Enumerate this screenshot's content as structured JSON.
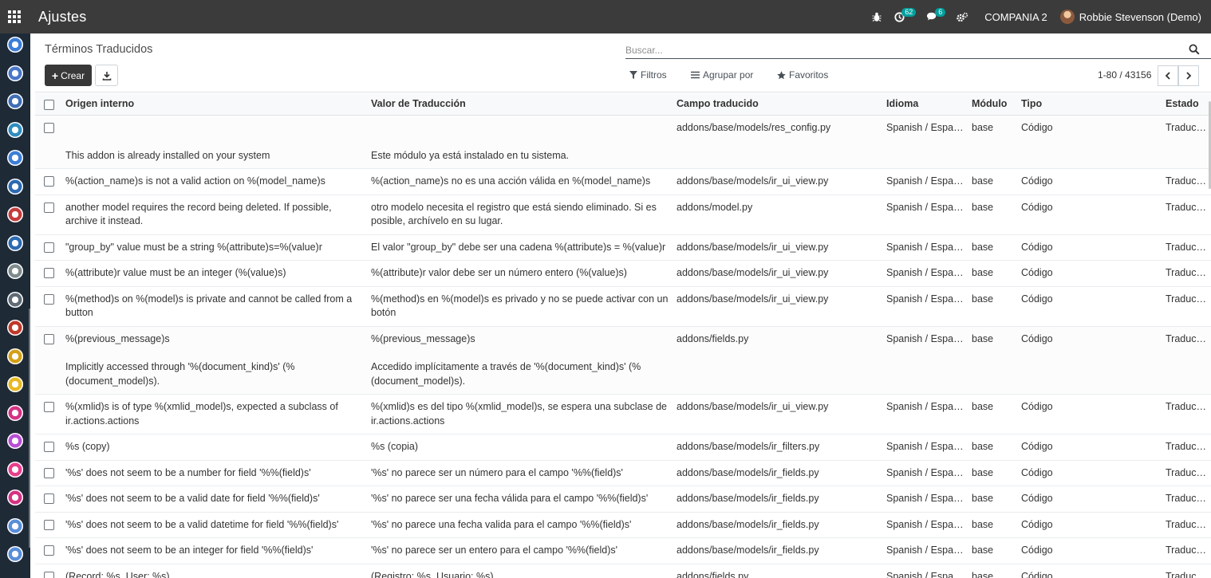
{
  "navbar": {
    "app_title": "Ajustes",
    "activity_count": "62",
    "messages_count": "6",
    "company": "COMPANIA 2",
    "user": "Robbie Stevenson (Demo)"
  },
  "sidebar": {
    "apps": [
      {
        "color": "#3d7ed8"
      },
      {
        "color": "#4a77c8"
      },
      {
        "color": "#3f6fb5"
      },
      {
        "color": "#2f8dbf"
      },
      {
        "color": "#3d7ed8"
      },
      {
        "color": "#2d6bb2"
      },
      {
        "color": "#c63d3d"
      },
      {
        "color": "#2d6bb2"
      },
      {
        "color": "#7f8c8d"
      },
      {
        "color": "#5f6b76"
      },
      {
        "color": "#c0392b"
      },
      {
        "color": "#d4a017"
      },
      {
        "color": "#e8b923"
      },
      {
        "color": "#d63384"
      },
      {
        "color": "#b84fd6"
      },
      {
        "color": "#e83e8c"
      },
      {
        "color": "#d63384"
      },
      {
        "color": "#5a8fd8"
      },
      {
        "color": "#5a8fd8"
      }
    ]
  },
  "control_panel": {
    "breadcrumb": "Términos Traducidos",
    "search_placeholder": "Buscar...",
    "create_label": "Crear",
    "filters_label": "Filtros",
    "group_by_label": "Agrupar por",
    "favorites_label": "Favoritos",
    "pager": "1-80 / 43156"
  },
  "table": {
    "columns": [
      "Origen interno",
      "Valor de Traducción",
      "Campo traducido",
      "Idioma",
      "Módulo",
      "Tipo",
      "Estado"
    ],
    "rows": [
      {
        "src": "",
        "src_note": "This addon is already installed on your system",
        "value": "",
        "value_note": "Este módulo ya está instalado en tu sistema.",
        "field": "addons/base/models/res_config.py",
        "lang": "Spanish / Español",
        "module": "base",
        "type": "Código",
        "state": "Traducido"
      },
      {
        "src": "%(action_name)s is not a valid action on %(model_name)s",
        "value": "%(action_name)s no es una acción válida en %(model_name)s",
        "field": "addons/base/models/ir_ui_view.py",
        "lang": "Spanish / Español",
        "module": "base",
        "type": "Código",
        "state": "Traducido"
      },
      {
        "src": " another model requires the record being deleted. If possible, archive it instead.",
        "value": " otro modelo necesita el registro que está siendo eliminado. Si es posible, archívelo en su lugar.",
        "field": "addons/model.py",
        "lang": "Spanish / Español",
        "module": "base",
        "type": "Código",
        "state": "Traducido"
      },
      {
        "src": "\"group_by\" value must be a string %(attribute)s=%(value)r",
        "value": "El valor \"group_by\" debe ser una cadena %(attribute)s = %(value)r",
        "field": "addons/base/models/ir_ui_view.py",
        "lang": "Spanish / Español",
        "module": "base",
        "type": "Código",
        "state": "Traducido"
      },
      {
        "src": "%(attribute)r value must be an integer (%(value)s)",
        "value": "%(attribute)r valor debe ser un número entero (%(value)s)",
        "field": "addons/base/models/ir_ui_view.py",
        "lang": "Spanish / Español",
        "module": "base",
        "type": "Código",
        "state": "Traducido"
      },
      {
        "src": "%(method)s on %(model)s is private and cannot be called from a button",
        "value": "%(method)s en %(model)s es privado y no se puede activar con un botón",
        "field": "addons/base/models/ir_ui_view.py",
        "lang": "Spanish / Español",
        "module": "base",
        "type": "Código",
        "state": "Traducido"
      },
      {
        "src": "%(previous_message)s",
        "src_note": "Implicitly accessed through '%(document_kind)s' (%(document_model)s).",
        "value": "%(previous_message)s",
        "value_note": "Accedido implícitamente a través de '%(document_kind)s' (%(document_model)s).",
        "field": "addons/fields.py",
        "lang": "Spanish / Español",
        "module": "base",
        "type": "Código",
        "state": "Traducido"
      },
      {
        "src": "%(xmlid)s is of type %(xmlid_model)s, expected a subclass of ir.actions.actions",
        "value": "%(xmlid)s es del tipo %(xmlid_model)s, se espera una subclase de ir.actions.actions",
        "field": "addons/base/models/ir_ui_view.py",
        "lang": "Spanish / Español",
        "module": "base",
        "type": "Código",
        "state": "Traducido"
      },
      {
        "src": "%s (copy)",
        "value": "%s (copia)",
        "field": "addons/base/models/ir_filters.py",
        "lang": "Spanish / Español",
        "module": "base",
        "type": "Código",
        "state": "Traducido"
      },
      {
        "src": "'%s' does not seem to be a number for field '%%(field)s'",
        "value": "'%s' no parece ser un número para el campo '%%(field)s'",
        "field": "addons/base/models/ir_fields.py",
        "lang": "Spanish / Español",
        "module": "base",
        "type": "Código",
        "state": "Traducido"
      },
      {
        "src": "'%s' does not seem to be a valid date for field '%%(field)s'",
        "value": "'%s' no parece ser una fecha válida para el campo '%%(field)s'",
        "field": "addons/base/models/ir_fields.py",
        "lang": "Spanish / Español",
        "module": "base",
        "type": "Código",
        "state": "Traducido"
      },
      {
        "src": "'%s' does not seem to be a valid datetime for field '%%(field)s'",
        "value": "'%s' no parece una fecha valida para el campo '%%(field)s'",
        "field": "addons/base/models/ir_fields.py",
        "lang": "Spanish / Español",
        "module": "base",
        "type": "Código",
        "state": "Traducido"
      },
      {
        "src": "'%s' does not seem to be an integer for field '%%(field)s'",
        "value": "'%s' no parece ser un entero para el campo '%%(field)s'",
        "field": "addons/base/models/ir_fields.py",
        "lang": "Spanish / Español",
        "module": "base",
        "type": "Código",
        "state": "Traducido"
      },
      {
        "src": "(Record: %s, User: %s)",
        "value": "(Registro: %s, Usuario: %s)",
        "field": "addons/fields.py",
        "lang": "Spanish / Español",
        "module": "base",
        "type": "Código",
        "state": "Traducido"
      }
    ]
  }
}
